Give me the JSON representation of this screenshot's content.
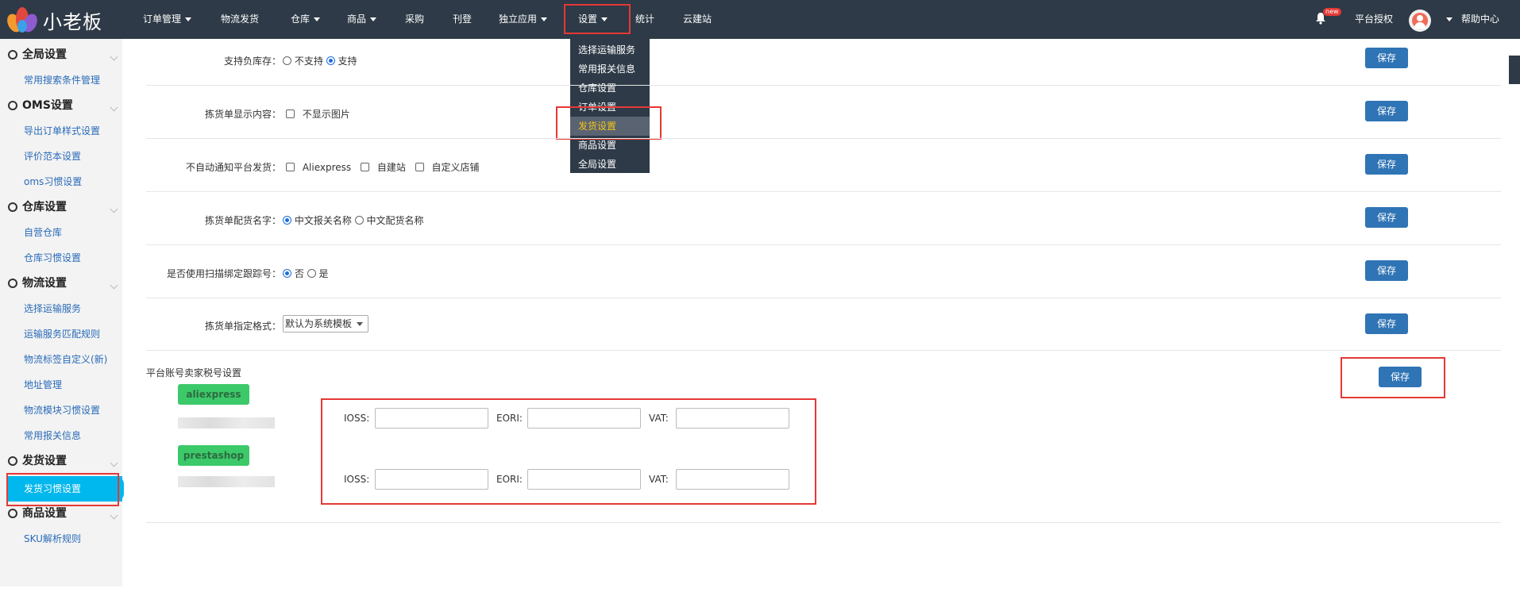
{
  "brand": {
    "name": "小老板"
  },
  "nav": {
    "items": [
      {
        "label": "订单管理",
        "dropdown": true
      },
      {
        "label": "物流发货",
        "dropdown": false
      },
      {
        "label": "仓库",
        "dropdown": true
      },
      {
        "label": "商品",
        "dropdown": true
      },
      {
        "label": "采购",
        "dropdown": false
      },
      {
        "label": "刊登",
        "dropdown": false
      },
      {
        "label": "独立应用",
        "dropdown": true
      },
      {
        "label": "设置",
        "dropdown": true
      },
      {
        "label": "统计",
        "dropdown": false
      },
      {
        "label": "云建站",
        "dropdown": false
      }
    ],
    "settings_menu": [
      "选择运输服务",
      "常用报关信息",
      "仓库设置",
      "订单设置",
      "发货设置",
      "商品设置",
      "全局设置"
    ],
    "settings_menu_active": "发货设置"
  },
  "header_right": {
    "new_badge": "new",
    "auth_label": "平台授权",
    "help_label": "帮助中心"
  },
  "sidebar": {
    "groups": [
      {
        "title": "全局设置",
        "items": [
          "常用搜索条件管理"
        ]
      },
      {
        "title": "OMS设置",
        "items": [
          "导出订单样式设置",
          "评价范本设置",
          "oms习惯设置"
        ]
      },
      {
        "title": "仓库设置",
        "items": [
          "自营仓库",
          "仓库习惯设置"
        ]
      },
      {
        "title": "物流设置",
        "items": [
          "选择运输服务",
          "运输服务匹配规则",
          "物流标签自定义(新)",
          "地址管理",
          "物流模块习惯设置",
          "常用报关信息"
        ]
      },
      {
        "title": "发货设置",
        "items": [
          "发货习惯设置"
        ]
      },
      {
        "title": "商品设置",
        "items": [
          "SKU解析规则"
        ]
      }
    ],
    "active_item": "发货习惯设置"
  },
  "settings": {
    "save_label": "保存",
    "negative_stock": {
      "label": "支持负库存：",
      "options": [
        "不支持",
        "支持"
      ],
      "selected": "支持"
    },
    "picking_display": {
      "label": "拣货单显示内容：",
      "option": "不显示图片",
      "checked": false
    },
    "no_notify": {
      "label": "不自动通知平台发货：",
      "options": [
        "Aliexpress",
        "自建站",
        "自定义店铺"
      ]
    },
    "picking_name": {
      "label": "拣货单配货名字：",
      "options": [
        "中文报关名称",
        "中文配货名称"
      ],
      "selected": "中文报关名称"
    },
    "scan_bind": {
      "label": "是否使用扫描绑定跟踪号：",
      "options": [
        "否",
        "是"
      ],
      "selected": "否"
    },
    "picking_format": {
      "label": "拣货单指定格式：",
      "value": "默认为系统模板"
    },
    "tax": {
      "section_label": "平台账号卖家税号设置",
      "fields": [
        "IOSS:",
        "EORI:",
        "VAT:"
      ],
      "platforms": [
        {
          "name": "aliexpress",
          "ioss": "",
          "eori": "",
          "vat": ""
        },
        {
          "name": "prestashop",
          "ioss": "",
          "eori": "",
          "vat": ""
        }
      ]
    }
  }
}
